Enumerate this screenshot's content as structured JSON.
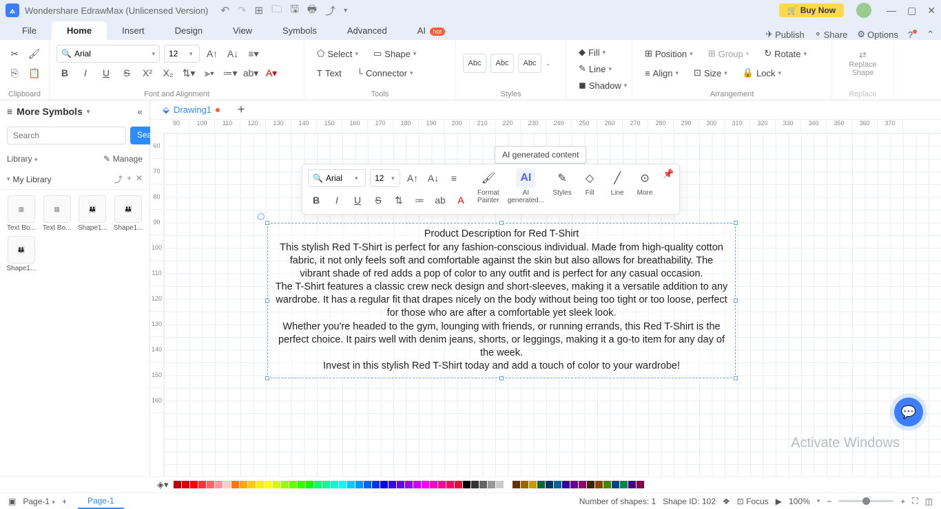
{
  "title": "Wondershare EdrawMax (Unlicensed Version)",
  "buy_now": "Buy Now",
  "menu": {
    "file": "File",
    "home": "Home",
    "insert": "Insert",
    "design": "Design",
    "view": "View",
    "symbols": "Symbols",
    "advanced": "Advanced",
    "ai": "AI",
    "hot": "hot",
    "publish": "Publish",
    "share": "Share",
    "options": "Options"
  },
  "ribbon": {
    "clipboard": "Clipboard",
    "font_alignment": "Font and Alignment",
    "tools": "Tools",
    "styles": "Styles",
    "arrangement": "Arrangement",
    "replace": "Replace",
    "font_name": "Arial",
    "font_size": "12",
    "select": "Select",
    "shape": "Shape",
    "text": "Text",
    "connector": "Connector",
    "abc": "Abc",
    "fill": "Fill",
    "line": "Line",
    "shadow": "Shadow",
    "position": "Position",
    "align": "Align",
    "group": "Group",
    "size": "Size",
    "rotate": "Rotate",
    "lock": "Lock",
    "replace_shape": "Replace\nShape"
  },
  "sidebar": {
    "more_symbols": "More Symbols",
    "search_placeholder": "Search",
    "search_btn": "Search",
    "library": "Library",
    "manage": "Manage",
    "my_library": "My Library",
    "items": [
      {
        "label": "Text Bo..."
      },
      {
        "label": "Text Bo..."
      },
      {
        "label": "Shape1..."
      },
      {
        "label": "Shape1..."
      },
      {
        "label": "Shape1..."
      }
    ]
  },
  "docs": {
    "drawing": "Drawing1"
  },
  "ruler_h": [
    "90",
    "100",
    "110",
    "120",
    "130",
    "140",
    "150",
    "160",
    "170",
    "180",
    "190",
    "200",
    "210",
    "220",
    "230",
    "240",
    "250",
    "260",
    "270",
    "280",
    "290",
    "300",
    "310",
    "320",
    "330",
    "340",
    "350",
    "360",
    "370"
  ],
  "ruler_v": [
    "60",
    "70",
    "80",
    "90",
    "100",
    "110",
    "120",
    "130",
    "140",
    "150",
    "160"
  ],
  "tooltip": "AI generated content",
  "float": {
    "font_name": "Arial",
    "font_size": "12",
    "format_painter": "Format\nPainter",
    "ai_gen": "AI\ngenerated...",
    "styles": "Styles",
    "fill": "Fill",
    "line": "Line",
    "more": "More"
  },
  "textbox": {
    "title": "Product Description for Red T-Shirt",
    "p1": "This stylish Red T-Shirt is perfect for any fashion-conscious individual. Made from high-quality cotton fabric, it not only feels soft and comfortable against the skin but also allows for breathability. The vibrant shade of red adds a pop of color to any outfit and is perfect for any casual occasion.",
    "p2": "The T-Shirt features a classic crew neck design and short-sleeves, making it a versatile addition to any wardrobe. It has a regular fit that drapes nicely on the body without being too tight or too loose, perfect for those who are after a comfortable yet sleek look.",
    "p3": "Whether you're headed to the gym, lounging with friends, or running errands, this Red T-Shirt is the perfect choice. It pairs well with denim jeans, shorts, or leggings, making it a go-to item for any day of the week.",
    "p4": "Invest in this stylish Red T-Shirt today and add a touch of color to your wardrobe!"
  },
  "status": {
    "page_sel": "Page-1",
    "page_tab": "Page-1",
    "shapes": "Number of shapes: 1",
    "shape_id": "Shape ID: 102",
    "focus": "Focus",
    "zoom": "100%"
  },
  "watermark": "Activate Windows",
  "colors": [
    "#b00",
    "#d00",
    "#f00",
    "#f33",
    "#f66",
    "#f99",
    "#fcc",
    "#f70",
    "#fa0",
    "#fc0",
    "#fe0",
    "#ff0",
    "#cf0",
    "#9f0",
    "#6f0",
    "#3f0",
    "#0f0",
    "#0f6",
    "#0f9",
    "#0fc",
    "#0ff",
    "#0cf",
    "#09f",
    "#06f",
    "#03f",
    "#00f",
    "#30f",
    "#60f",
    "#90f",
    "#c0f",
    "#f0f",
    "#f0c",
    "#f09",
    "#f06",
    "#f03",
    "#000",
    "#333",
    "#666",
    "#999",
    "#ccc",
    "#fff",
    "#630",
    "#960",
    "#c90",
    "#063",
    "#036",
    "#069",
    "#309",
    "#609",
    "#906",
    "#420",
    "#840",
    "#480",
    "#048",
    "#084",
    "#408",
    "#804"
  ]
}
